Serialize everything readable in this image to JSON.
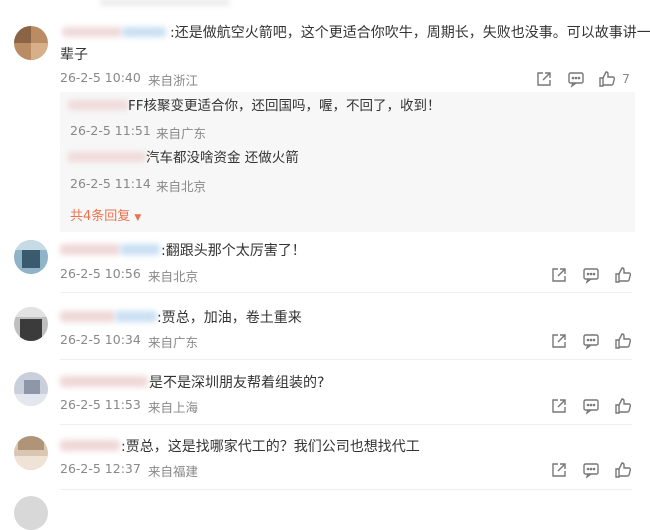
{
  "colors": {
    "link": "#eb7350",
    "meta": "#888888",
    "reply_bg": "#f7f7f7"
  },
  "comments": [
    {
      "text_line1": ":还是做航空火箭吧，这个更适合你吹牛，周期长，失败也没事。可以故事讲一",
      "text_line2": "辈子",
      "time": "26-2-5 10:40",
      "location": "来自浙江",
      "like_count": "7",
      "icons": [
        "share-icon",
        "comment-icon",
        "like-icon"
      ],
      "replies": [
        {
          "text": "FF核聚变更适合你，还回国吗，喔，不回了，收到！",
          "time": "26-2-5 11:51",
          "location": "来自广东"
        },
        {
          "text": "汽车都没啥资金  还做火箭",
          "time": "26-2-5 11:14",
          "location": "来自北京"
        }
      ],
      "more_replies": "共4条回复"
    },
    {
      "text_line1": ":翻跟头那个太厉害了！",
      "time": "26-2-5 10:56",
      "location": "来自北京"
    },
    {
      "text_line1": ":贾总，加油，卷土重来",
      "time": "26-2-5 10:34",
      "location": "来自广东"
    },
    {
      "text_line1": "是不是深圳朋友帮着组装的?",
      "time": "26-2-5 11:53",
      "location": "来自上海"
    },
    {
      "text_line1": ":贾总，这是找哪家代工的？我们公司也想找代工",
      "time": "26-2-5 12:37",
      "location": "来自福建"
    }
  ]
}
